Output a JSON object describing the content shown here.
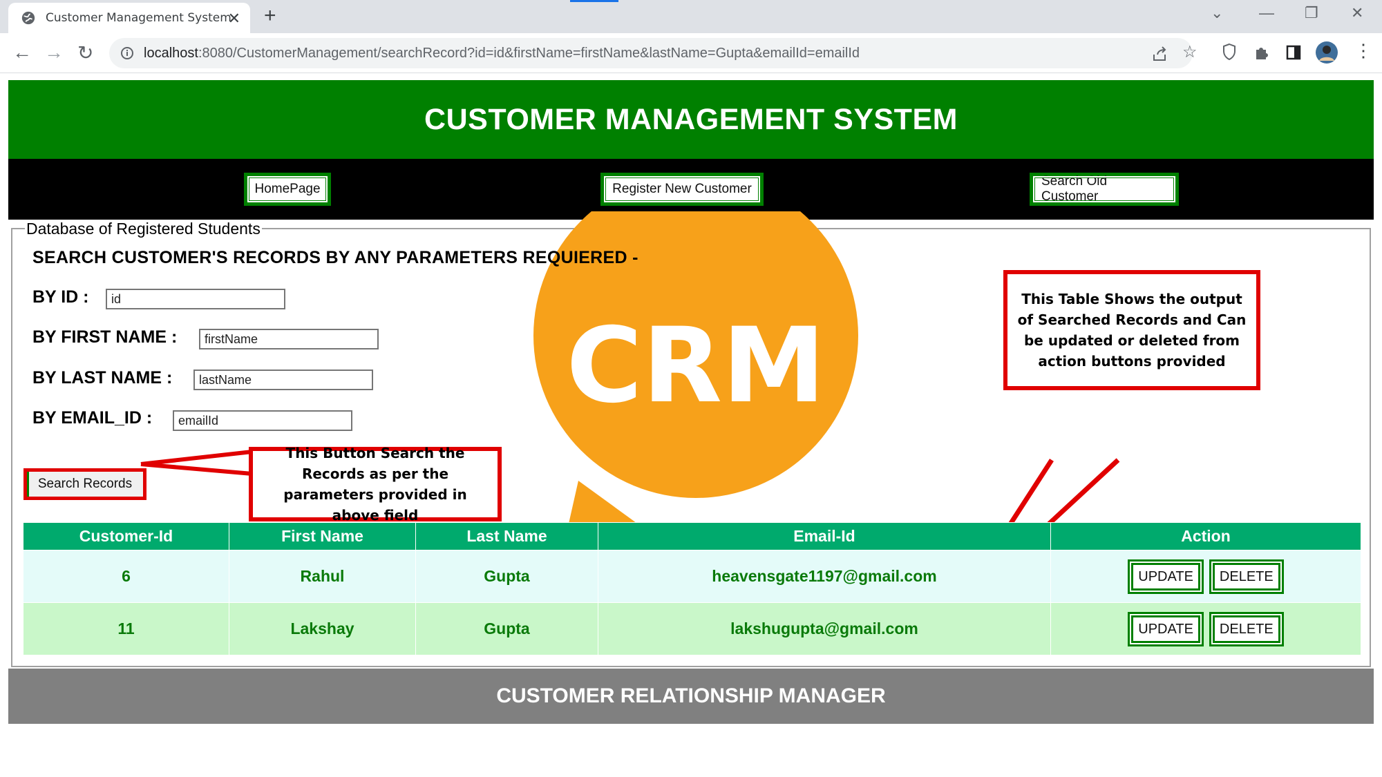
{
  "browser": {
    "tab_title": "Customer Management System",
    "url_host": "localhost",
    "url_path": ":8080/CustomerManagement/searchRecord?id=id&firstName=firstName&lastName=Gupta&emailId=emailId"
  },
  "header": {
    "title": "CUSTOMER MANAGEMENT SYSTEM"
  },
  "nav": {
    "home": "HomePage",
    "register": "Register New Customer",
    "search": "Search Old Customer"
  },
  "fieldset": {
    "legend": "Database of Registered Students"
  },
  "logo": {
    "text": "CRM"
  },
  "form": {
    "title": "SEARCH CUSTOMER'S RECORDS BY ANY PARAMETERS REQUIERED -",
    "id_label": "BY ID :",
    "id_value": "id",
    "first_label": "BY FIRST NAME :",
    "first_value": "firstName",
    "last_label": "BY LAST NAME :",
    "last_value": "lastName",
    "email_label": "BY EMAIL_ID :",
    "email_value": "emailId",
    "search_button": "Search Records"
  },
  "callouts": {
    "button_note": "This Button Search the Records as per the parameters provided in above field",
    "table_note": "This Table Shows the output of Searched Records and Can be updated or deleted from action buttons provided"
  },
  "table": {
    "headers": [
      "Customer-Id",
      "First Name",
      "Last Name",
      "Email-Id",
      "Action"
    ],
    "rows": [
      {
        "id": "6",
        "first": "Rahul",
        "last": "Gupta",
        "email": "heavensgate1197@gmail.com"
      },
      {
        "id": "11",
        "first": "Lakshay",
        "last": "Gupta",
        "email": "lakshugupta@gmail.com"
      }
    ],
    "update_label": "UPDATE",
    "delete_label": "DELETE"
  },
  "footer": {
    "text": "CUSTOMER RELATIONSHIP MANAGER"
  },
  "colors": {
    "header_green": "#008000",
    "table_header": "#00aa6d",
    "row_a": "#e4fbf9",
    "row_b": "#c9f7c9",
    "callout_red": "#e00000",
    "logo_orange": "#f7a11a",
    "footer_gray": "#808080"
  },
  "icons": [
    "globe-icon",
    "close-icon",
    "plus-icon",
    "back-icon",
    "forward-icon",
    "reload-icon",
    "info-icon",
    "share-icon",
    "star-icon",
    "shield-icon",
    "puzzle-icon",
    "sidebar-icon",
    "avatar",
    "menu-icon"
  ]
}
